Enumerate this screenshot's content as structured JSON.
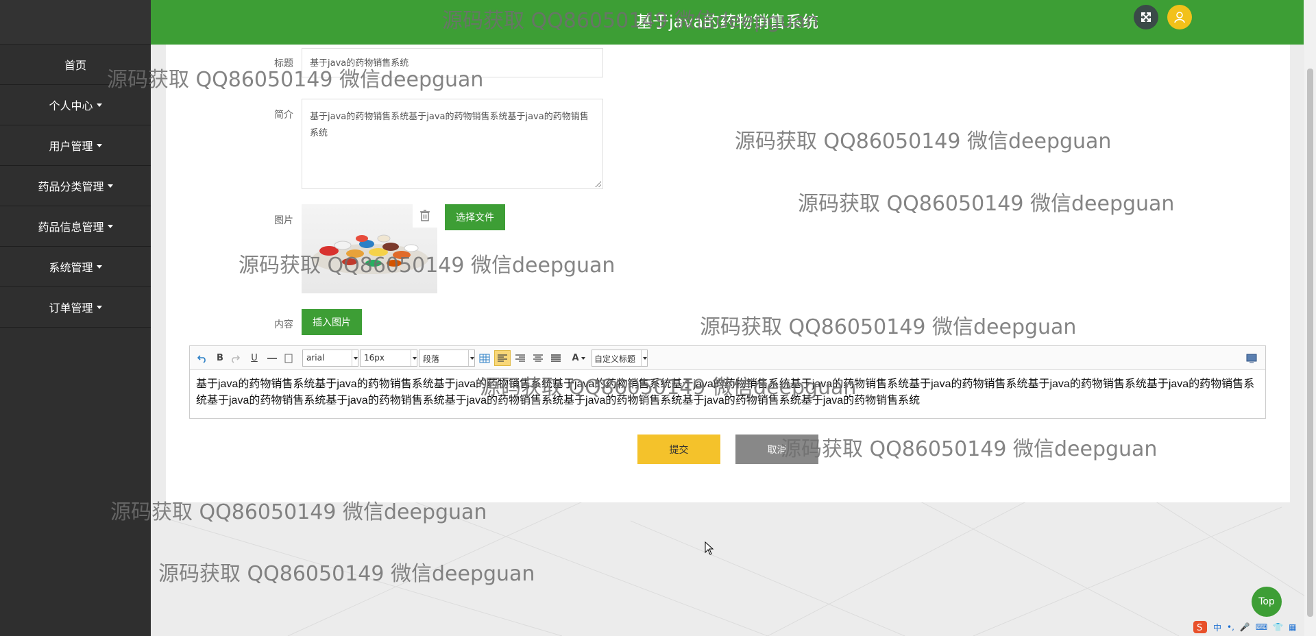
{
  "app": {
    "title": "基于java的药物销售系统"
  },
  "sidebar": {
    "items": [
      {
        "label": "首页",
        "has_caret": false
      },
      {
        "label": "个人中心",
        "has_caret": true
      },
      {
        "label": "用户管理",
        "has_caret": true
      },
      {
        "label": "药品分类管理",
        "has_caret": true
      },
      {
        "label": "药品信息管理",
        "has_caret": true
      },
      {
        "label": "系统管理",
        "has_caret": true
      },
      {
        "label": "订单管理",
        "has_caret": true
      }
    ]
  },
  "form": {
    "title_label": "标题",
    "title_value": "基于java的药物销售系统",
    "intro_label": "简介",
    "intro_value": "基于java的药物销售系统基于java的药物销售系统基于java的药物销售系统",
    "image_label": "图片",
    "choose_file_label": "选择文件",
    "content_label": "内容",
    "insert_image_label": "插入图片",
    "submit_label": "提交",
    "cancel_label": "取消"
  },
  "editor": {
    "font_family": "arial",
    "font_size": "16px",
    "paragraph": "段落",
    "custom_heading": "自定义标题",
    "content": "基于java的药物销售系统基于java的药物销售系统基于java的药物销售系统基于java的药物销售系统基于java的药物销售系统基于java的药物销售系统基于java的药物销售系统基于java的药物销售系统基于java的药物销售系统基于java的药物销售系统基于java的药物销售系统基于java的药物销售系统基于java的药物销售系统基于java的药物销售系统基于java的药物销售系统"
  },
  "top_button": "Top",
  "watermark_text": "源码获取 QQ86050149 微信deepguan",
  "ime": {
    "label": "中"
  },
  "colors": {
    "primary": "#3d9e35",
    "sidebar": "#2f2f2f",
    "submit": "#f4c22b",
    "cancel": "#888888",
    "user_avatar": "#f2c11a"
  }
}
